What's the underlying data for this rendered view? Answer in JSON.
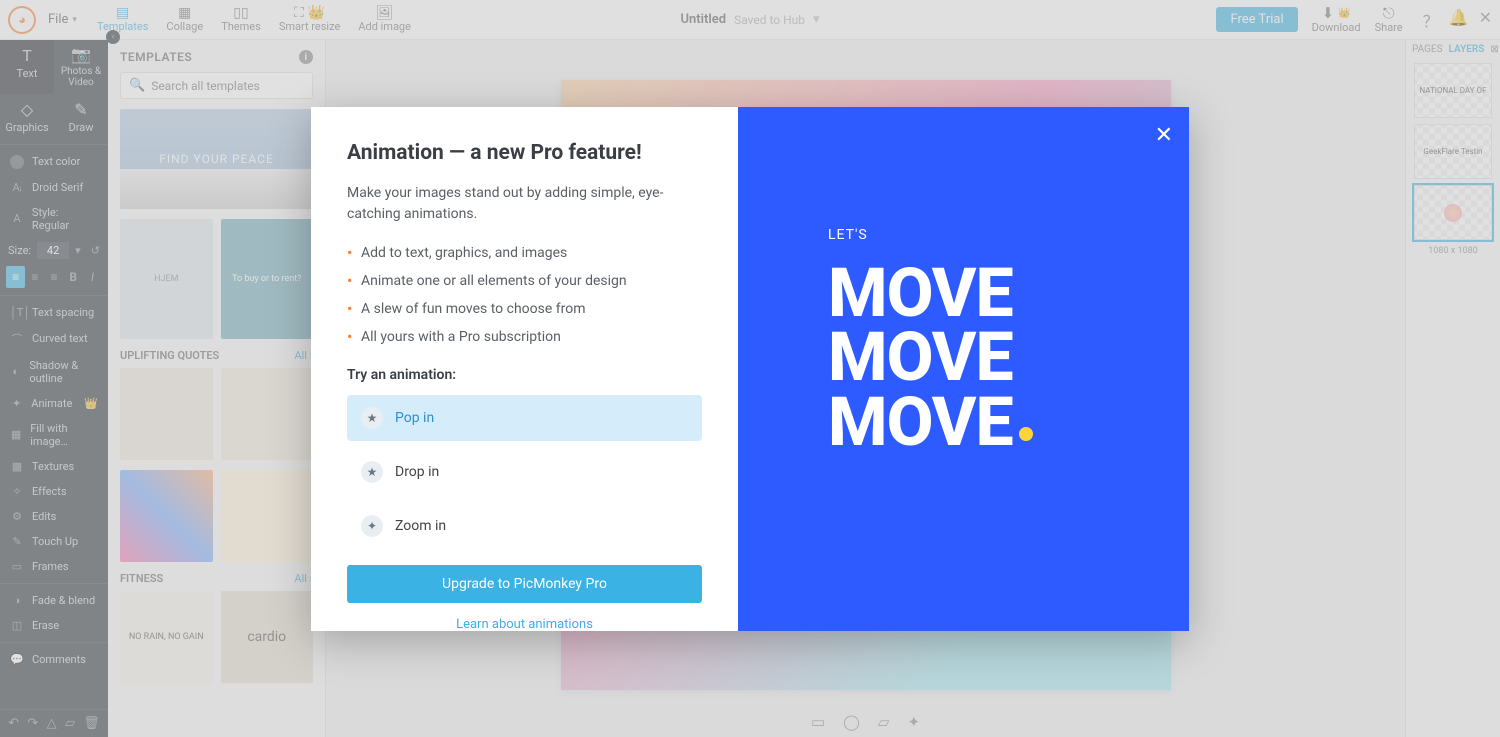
{
  "topbar": {
    "file": "File",
    "actions": [
      {
        "label": "Templates",
        "active": true
      },
      {
        "label": "Collage",
        "active": false
      },
      {
        "label": "Themes",
        "active": false
      },
      {
        "label": "Smart resize",
        "active": false
      },
      {
        "label": "Add image",
        "active": false
      }
    ],
    "doc_title": "Untitled",
    "saved_state": "Saved to Hub",
    "free_trial": "Free Trial",
    "download": "Download",
    "share": "Share"
  },
  "left_rail": {
    "tab_text": "Text",
    "tab_photos": "Photos & Video",
    "tab_graphics": "Graphics",
    "tab_draw": "Draw",
    "text_color": "Text color",
    "font": "Droid Serif",
    "style": "Style: Regular",
    "size_label": "Size:",
    "size_value": "42",
    "items": [
      "Text spacing",
      "Curved text",
      "Shadow & outline",
      "Animate",
      "Fill with image…",
      "Textures",
      "Effects",
      "Edits",
      "Touch Up",
      "Frames",
      "Fade & blend",
      "Erase",
      "Comments"
    ]
  },
  "templates": {
    "header": "TEMPLATES",
    "search_placeholder": "Search all templates",
    "hero_text": "FIND YOUR PEACE",
    "card_hjem": "HJEM",
    "card_buy": "To buy or to rent?",
    "section_uplifting": "UPLIFTING QUOTES",
    "section_fitness": "FITNESS",
    "all_link": "All",
    "card_norain": "NO RAIN, NO GAIN",
    "card_cardio": "cardio"
  },
  "right_panel": {
    "tab_pages": "PAGES",
    "tab_layers": "LAYERS",
    "thumb1": "NATIONAL DAY OF",
    "thumb2": "GeekFlare Testin",
    "dims": "1080 x 1080"
  },
  "modal": {
    "title": "Animation — a new Pro feature!",
    "lead": "Make your images stand out by adding simple, eye-catching animations.",
    "bullets": [
      "Add to text, graphics, and images",
      "Animate one or all elements of your design",
      "A slew of fun moves to choose from",
      "All yours with a Pro subscription"
    ],
    "try_label": "Try an animation:",
    "options": [
      {
        "label": "Pop in",
        "selected": true
      },
      {
        "label": "Drop in",
        "selected": false
      },
      {
        "label": "Zoom in",
        "selected": false
      }
    ],
    "upgrade": "Upgrade to PicMonkey Pro",
    "learn": "Learn about animations",
    "preview_lets": "LET'S",
    "preview_move": "MOVE"
  }
}
